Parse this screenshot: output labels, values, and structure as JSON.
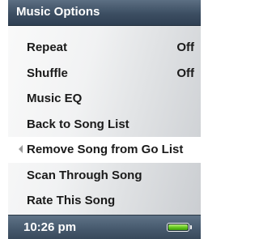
{
  "header": {
    "title": "Music Options"
  },
  "menu": {
    "items": [
      {
        "label": "Repeat",
        "value": "Off"
      },
      {
        "label": "Shuffle",
        "value": "Off"
      },
      {
        "label": "Music EQ"
      },
      {
        "label": "Back to Song List"
      },
      {
        "label": "Remove Song from Go List",
        "selected": true
      },
      {
        "label": "Scan Through Song"
      },
      {
        "label": "Rate This Song"
      }
    ]
  },
  "status": {
    "time": "10:26 pm",
    "battery_level": 1.0,
    "battery_color": "#62c61c"
  },
  "colors": {
    "bar_accent": "#3c4e62",
    "selected_row": "#ffffff"
  }
}
